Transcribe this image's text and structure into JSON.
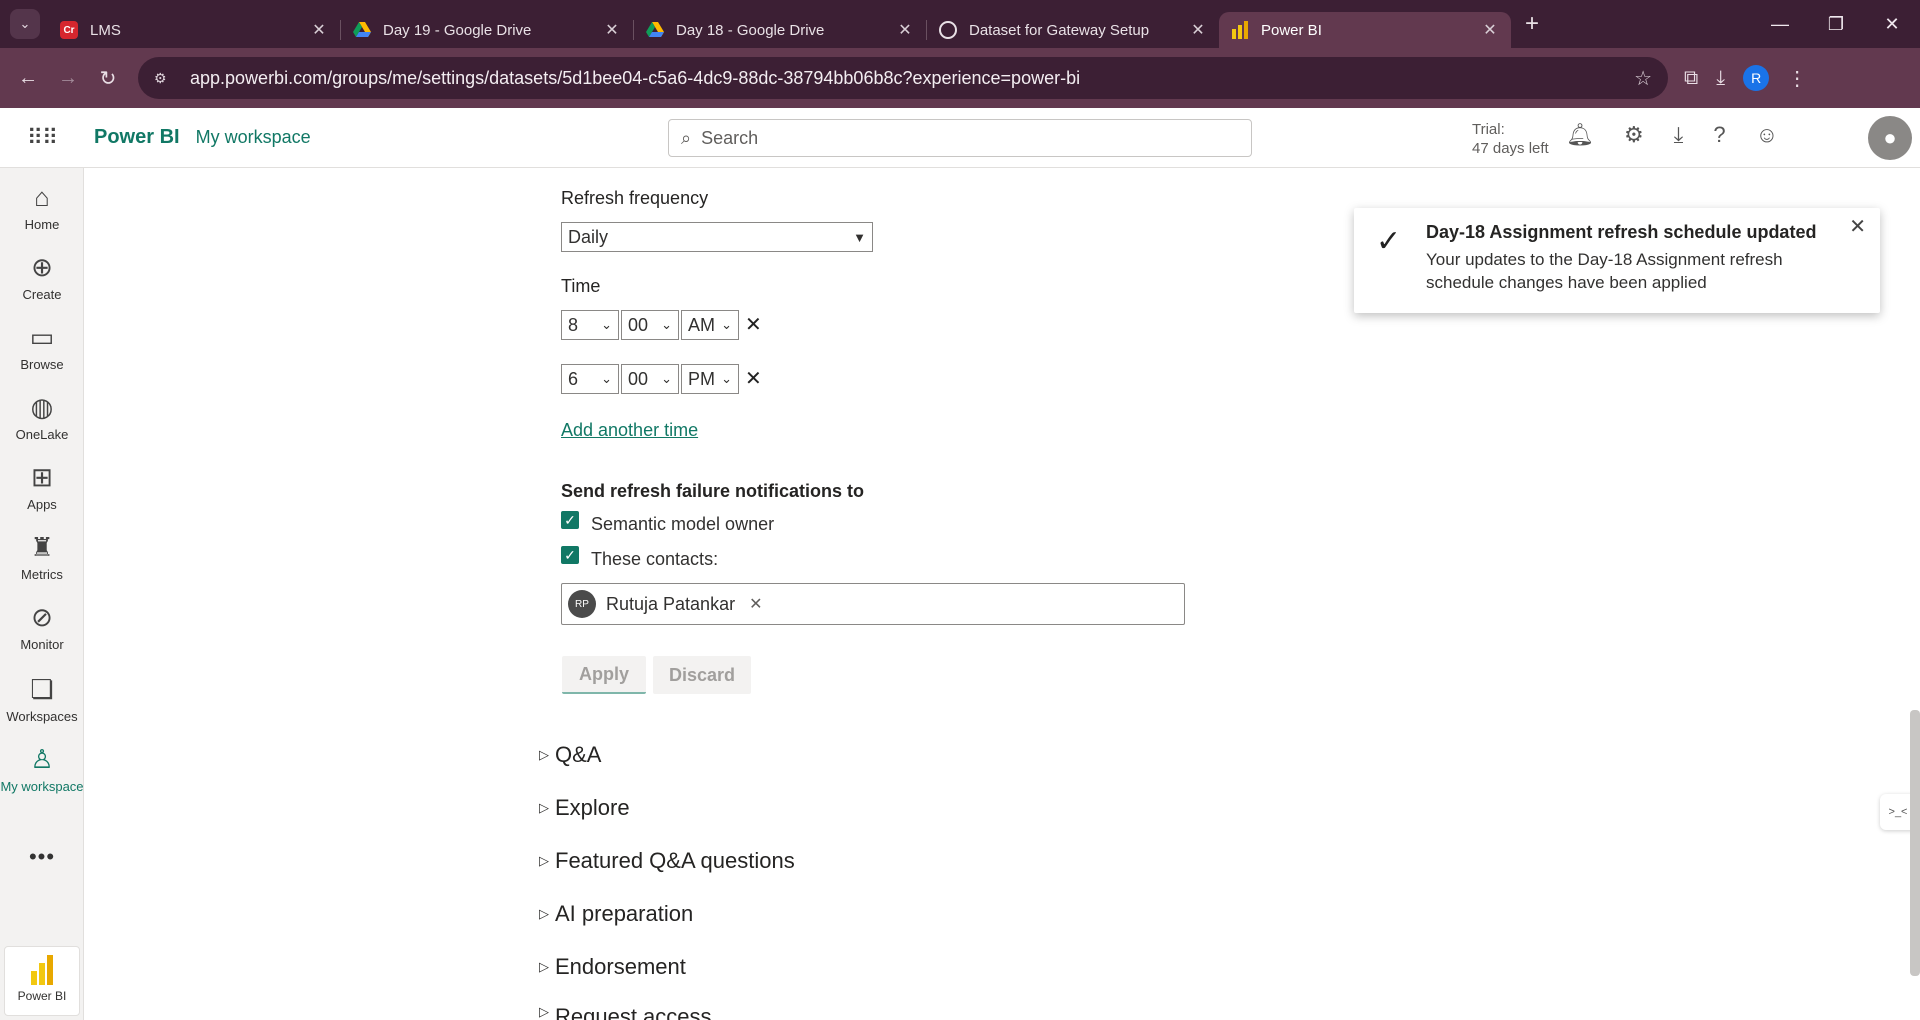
{
  "browser": {
    "tabs": [
      {
        "label": "LMS",
        "icon": "lms-icon",
        "close": "✕"
      },
      {
        "label": "Day 19 - Google Drive",
        "icon": "google-drive-icon",
        "close": "✕"
      },
      {
        "label": "Day 18 - Google Drive",
        "icon": "google-drive-icon",
        "close": "✕"
      },
      {
        "label": "Dataset for Gateway Setup",
        "icon": "openai-icon",
        "close": "✕"
      },
      {
        "label": "Power BI",
        "icon": "power-bi-icon",
        "close": "✕"
      }
    ],
    "url": "app.powerbi.com/groups/me/settings/datasets/5d1bee04-c5a6-4dc9-88dc-38794bb06b8c?experience=power-bi",
    "profile_initial": "R"
  },
  "header": {
    "brand": "Power BI",
    "workspace": "My workspace",
    "search_placeholder": "Search",
    "trial_line1": "Trial:",
    "trial_line2": "47 days left"
  },
  "leftnav": [
    {
      "label": "Home",
      "icon": "home-icon"
    },
    {
      "label": "Create",
      "icon": "create-icon"
    },
    {
      "label": "Browse",
      "icon": "browse-icon"
    },
    {
      "label": "OneLake",
      "icon": "onelake-icon"
    },
    {
      "label": "Apps",
      "icon": "apps-icon"
    },
    {
      "label": "Metrics",
      "icon": "metrics-icon"
    },
    {
      "label": "Monitor",
      "icon": "monitor-icon"
    },
    {
      "label": "Workspaces",
      "icon": "workspaces-icon"
    },
    {
      "label": "My workspace",
      "icon": "my-workspace-icon",
      "selected": true
    }
  ],
  "leftnav_footer": "Power BI",
  "form": {
    "refresh_frequency_label": "Refresh frequency",
    "refresh_frequency_value": "Daily",
    "time_label": "Time",
    "times": [
      {
        "hour": "8",
        "minute": "00",
        "ampm": "AM"
      },
      {
        "hour": "6",
        "minute": "00",
        "ampm": "PM"
      }
    ],
    "add_time_link": "Add another time",
    "notify_label": "Send refresh failure notifications to",
    "owner_checkbox": {
      "label": "Semantic model owner",
      "checked": true
    },
    "contacts_checkbox": {
      "label": "These contacts:",
      "checked": true
    },
    "contact": {
      "initials": "RP",
      "name": "Rutuja Patankar"
    },
    "apply_label": "Apply",
    "discard_label": "Discard"
  },
  "sections": [
    "Q&A",
    "Explore",
    "Featured Q&A questions",
    "AI preparation",
    "Endorsement",
    "Request access"
  ],
  "toast": {
    "title": "Day-18 Assignment refresh schedule updated",
    "body": "Your updates to the Day-18 Assignment refresh schedule changes have been applied"
  },
  "colors": {
    "accent": "#117865",
    "chrome": "#62394f",
    "chrome_dark": "#3c1f34"
  }
}
